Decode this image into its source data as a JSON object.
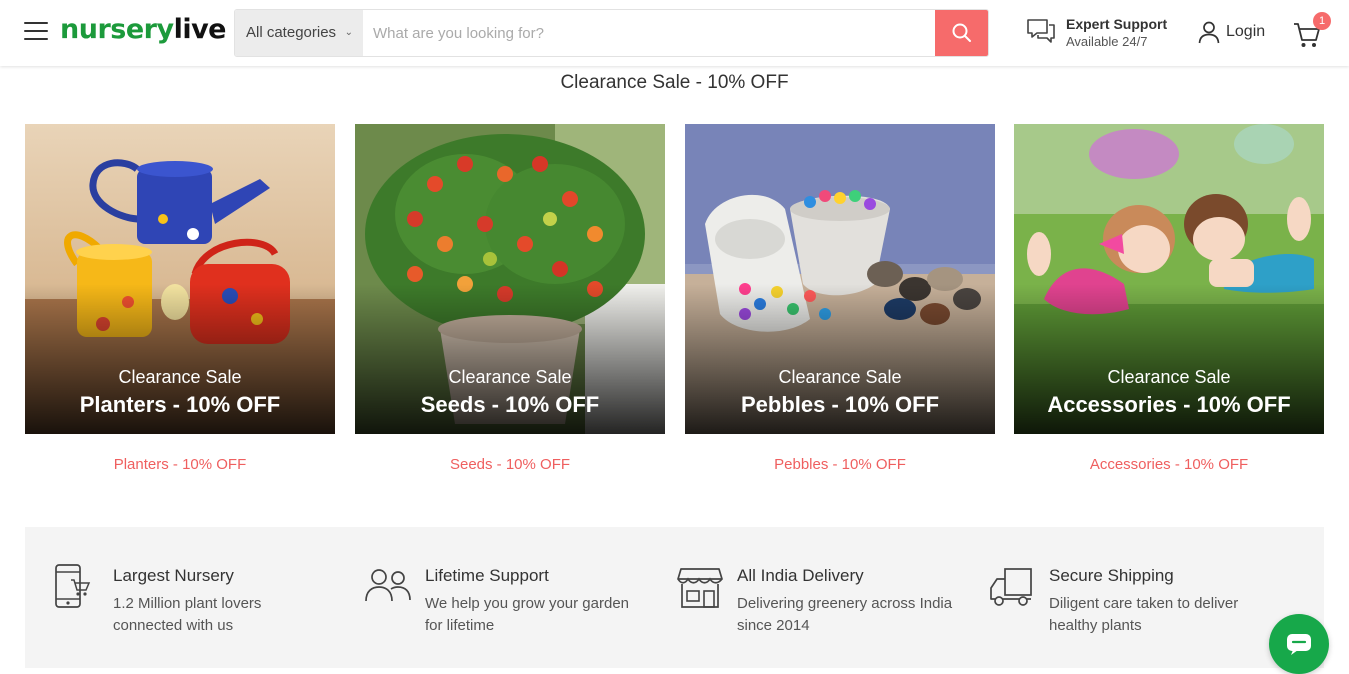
{
  "header": {
    "logo_green": "nursery",
    "logo_dark": "live",
    "search": {
      "category": "All categories",
      "placeholder": "What are you looking for?"
    },
    "support": {
      "title": "Expert Support",
      "subtitle": "Available 24/7"
    },
    "login_label": "Login",
    "cart_count": "1",
    "accent_color": "#f66b6b",
    "brand_color": "#1c9a3b"
  },
  "section_title": "Clearance Sale - 10% OFF",
  "cards": [
    {
      "subtitle": "Clearance Sale",
      "title": "Planters - 10% OFF",
      "link": "Planters - 10% OFF"
    },
    {
      "subtitle": "Clearance Sale",
      "title": "Seeds - 10% OFF",
      "link": "Seeds - 10% OFF"
    },
    {
      "subtitle": "Clearance Sale",
      "title": "Pebbles - 10% OFF",
      "link": "Pebbles - 10% OFF"
    },
    {
      "subtitle": "Clearance Sale",
      "title": "Accessories - 10% OFF",
      "link": "Accessories - 10% OFF"
    }
  ],
  "features": [
    {
      "icon": "phone-cart-icon",
      "title": "Largest Nursery",
      "desc": "1.2 Million plant lovers connected with us"
    },
    {
      "icon": "users-icon",
      "title": "Lifetime Support",
      "desc": "We help you grow your garden for lifetime"
    },
    {
      "icon": "storefront-icon",
      "title": "All India Delivery",
      "desc": "Delivering greenery across India since 2014"
    },
    {
      "icon": "truck-icon",
      "title": "Secure Shipping",
      "desc": "Diligent care taken to deliver healthy  plants"
    }
  ]
}
